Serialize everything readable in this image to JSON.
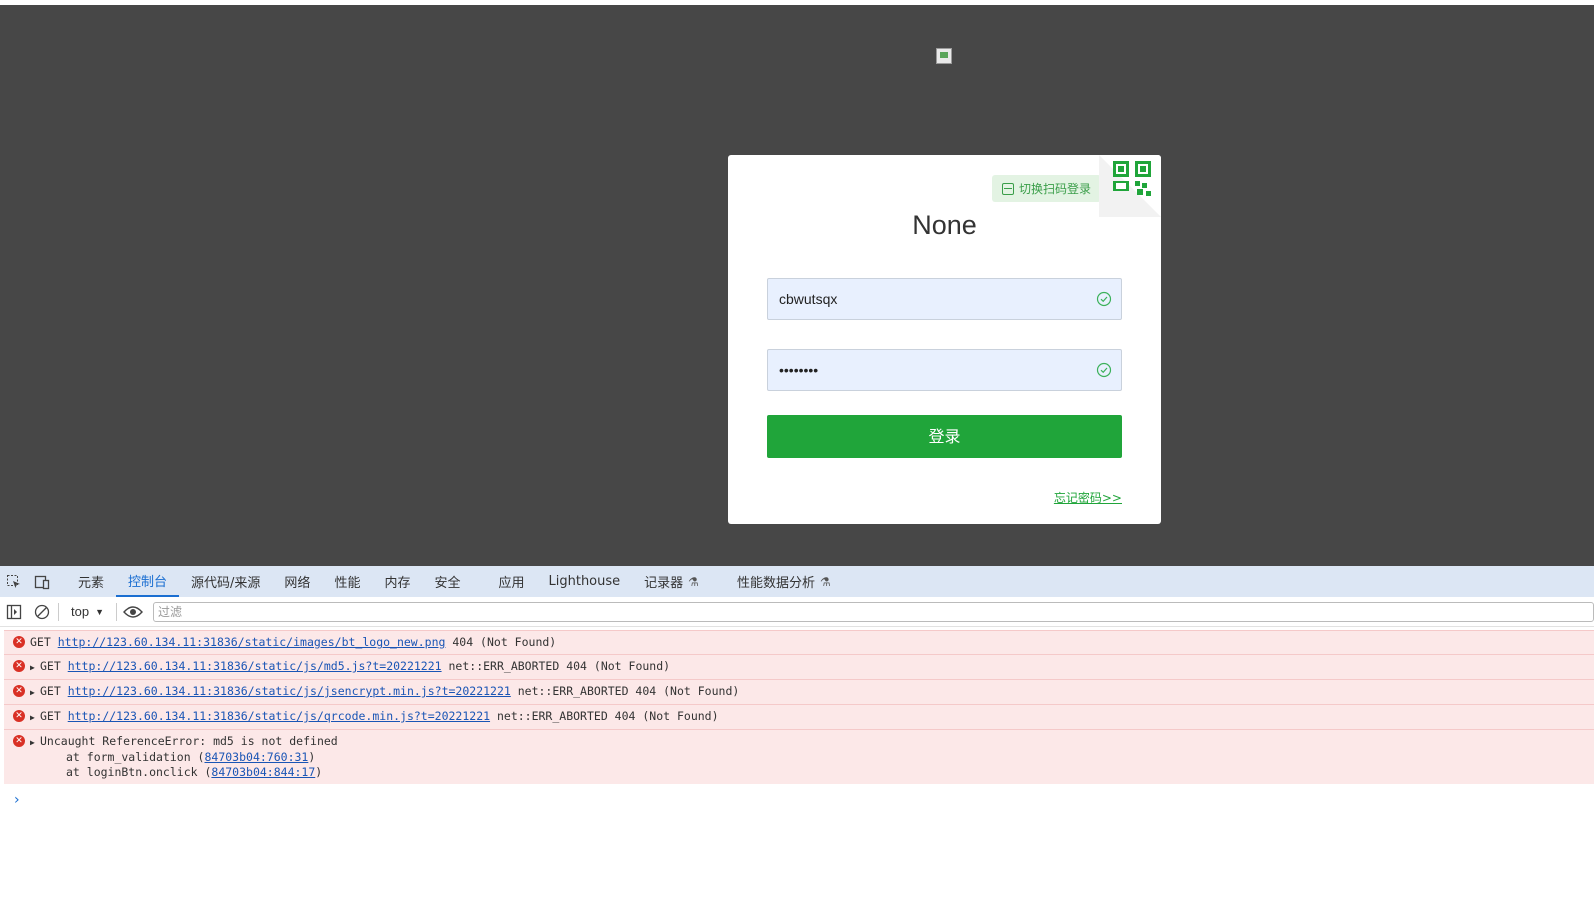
{
  "login": {
    "title": "None",
    "qr_switch_label": "切换扫码登录",
    "username": "cbwutsqx",
    "password_masked": "••••••••",
    "login_button": "登录",
    "forgot_link": "忘记密码>>"
  },
  "devtools": {
    "tabs": [
      "元素",
      "控制台",
      "源代码/来源",
      "网络",
      "性能",
      "内存",
      "安全",
      "应用",
      "Lighthouse",
      "记录器",
      "性能数据分析"
    ],
    "active_tab": "控制台",
    "context": "top",
    "filter_placeholder": "过滤"
  },
  "console": {
    "messages": [
      {
        "prefix": "GET ",
        "url": "http://123.60.134.11:31836/static/images/bt_logo_new.png",
        "suffix": " 404 (Not Found)"
      },
      {
        "prefix": "GET ",
        "url": "http://123.60.134.11:31836/static/js/md5.js?t=20221221",
        "suffix": " net::ERR_ABORTED 404 (Not Found)"
      },
      {
        "prefix": "GET ",
        "url": "http://123.60.134.11:31836/static/js/jsencrypt.min.js?t=20221221",
        "suffix": " net::ERR_ABORTED 404 (Not Found)"
      },
      {
        "prefix": "GET ",
        "url": "http://123.60.134.11:31836/static/js/qrcode.min.js?t=20221221",
        "suffix": " net::ERR_ABORTED 404 (Not Found)"
      }
    ],
    "error": {
      "text": "Uncaught ReferenceError: md5 is not defined",
      "stack1_prefix": "at form_validation (",
      "stack1_link": "84703b04:760:31",
      "stack2_prefix": "at loginBtn.onclick (",
      "stack2_link": "84703b04:844:17",
      "close_paren": ")"
    },
    "prompt": "›"
  },
  "colors": {
    "page_bg": "#474747",
    "brand_green": "#20a53a",
    "error_bg": "#fce8e8",
    "link_blue": "#1a55b5"
  }
}
